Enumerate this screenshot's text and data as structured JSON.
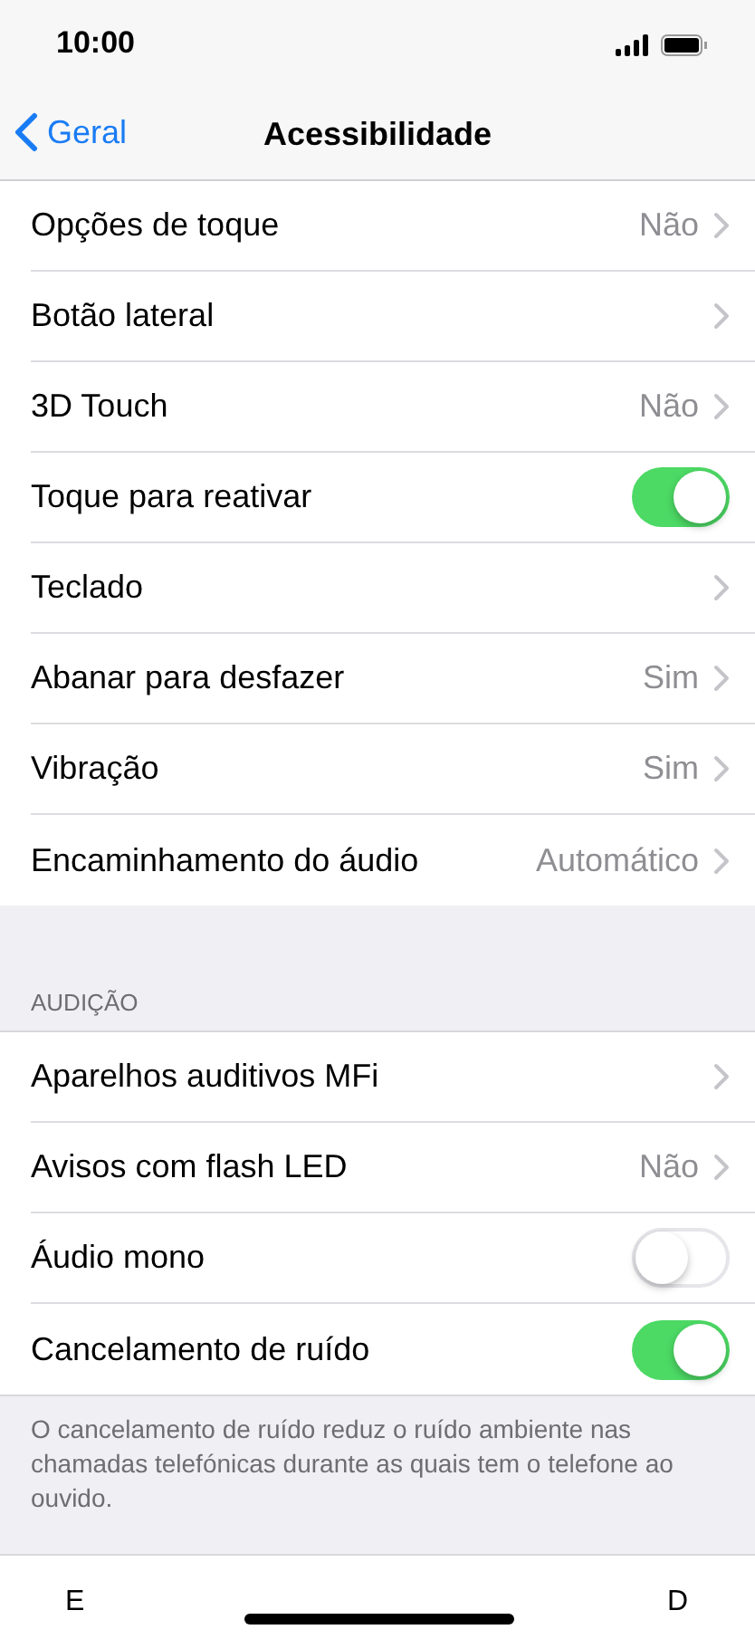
{
  "status_bar": {
    "time": "10:00"
  },
  "nav": {
    "back": "Geral",
    "title": "Acessibilidade"
  },
  "sections": [
    {
      "rows": [
        {
          "kind": "value",
          "label": "Opções de toque",
          "value": "Não"
        },
        {
          "kind": "link",
          "label": "Botão lateral"
        },
        {
          "kind": "value",
          "label": "3D Touch",
          "value": "Não"
        },
        {
          "kind": "toggle",
          "label": "Toque para reativar",
          "on": true
        },
        {
          "kind": "link",
          "label": "Teclado"
        },
        {
          "kind": "value",
          "label": "Abanar para desfazer",
          "value": "Sim"
        },
        {
          "kind": "value",
          "label": "Vibração",
          "value": "Sim"
        },
        {
          "kind": "value",
          "label": "Encaminhamento do áudio",
          "value": "Automático"
        }
      ]
    },
    {
      "header": "AUDIÇÃO",
      "rows": [
        {
          "kind": "link",
          "label": "Aparelhos auditivos MFi"
        },
        {
          "kind": "value",
          "label": "Avisos com flash LED",
          "value": "Não"
        },
        {
          "kind": "toggle",
          "label": "Áudio mono",
          "on": false
        },
        {
          "kind": "toggle",
          "label": "Cancelamento de ruído",
          "on": true
        }
      ],
      "footer": "O cancelamento de ruído reduz o ruído ambiente nas chamadas telefónicas durante as quais tem o telefone ao ouvido."
    }
  ],
  "bottom_bar": {
    "left": "E",
    "right": "D"
  }
}
